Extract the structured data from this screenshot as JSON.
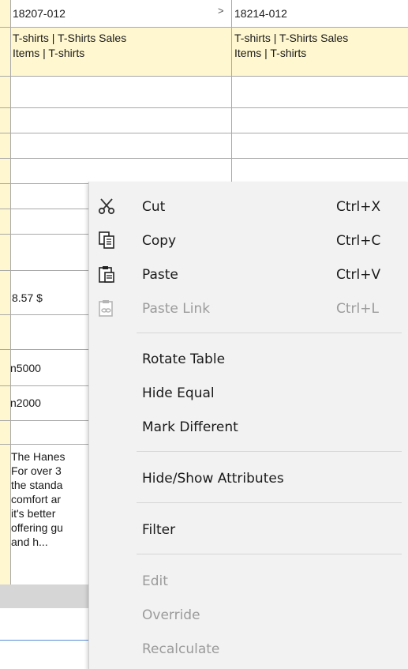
{
  "table": {
    "col1_header": "18207-012",
    "col2_header": "18214-012",
    "col1_category_line1": "T-shirts | T-Shirts Sales",
    "col1_category_line2": "Items | T-shirts",
    "col2_category_line1": "T-shirts | T-Shirts Sales",
    "col2_category_line2": "Items | T-shirts",
    "price": "8.57 $",
    "row_a": "n5000",
    "row_b": "n2000",
    "description_lines": [
      "The Hanes",
      "For over 3",
      "the standa",
      "comfort ar",
      "it's better",
      "offering gu",
      "and h..."
    ]
  },
  "context_menu": {
    "items": [
      {
        "label": "Cut",
        "shortcut": "Ctrl+X",
        "icon": "scissors-icon"
      },
      {
        "label": "Copy",
        "shortcut": "Ctrl+C",
        "icon": "copy-icon"
      },
      {
        "label": "Paste",
        "shortcut": "Ctrl+V",
        "icon": "paste-icon"
      },
      {
        "label": "Paste Link",
        "shortcut": "Ctrl+L",
        "icon": "paste-link-icon"
      },
      {
        "label": "Rotate Table"
      },
      {
        "label": "Hide Equal"
      },
      {
        "label": "Mark Different"
      },
      {
        "label": "Hide/Show Attributes"
      },
      {
        "label": "Filter"
      },
      {
        "label": "Edit"
      },
      {
        "label": "Override"
      },
      {
        "label": "Recalculate"
      }
    ]
  },
  "colors": {
    "attribute_highlight": "#fff7cf",
    "menu_background": "#f2f2f2",
    "disabled_text": "#9b9b9b"
  }
}
